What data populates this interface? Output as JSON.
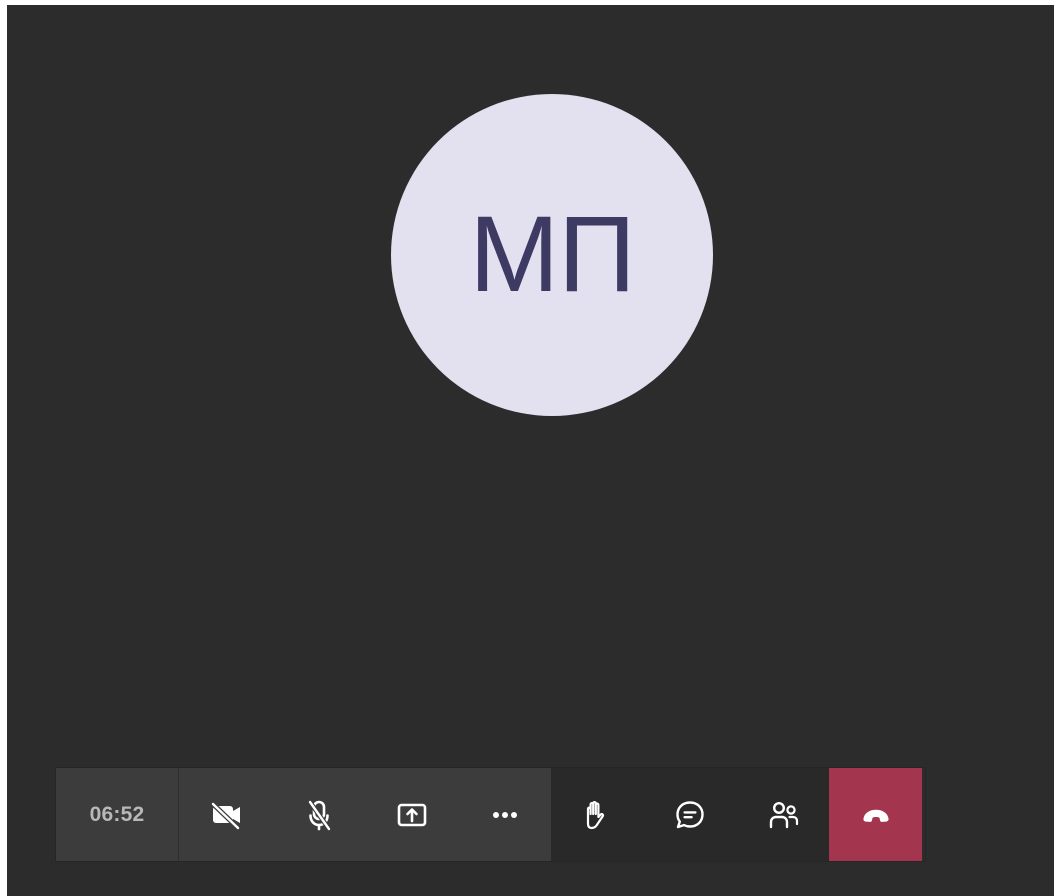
{
  "call": {
    "participant_initials": "МП",
    "elapsed_time": "06:52"
  },
  "controls": {
    "camera": {
      "icon": "camera-off-icon"
    },
    "microphone": {
      "icon": "microphone-off-icon"
    },
    "share": {
      "icon": "share-screen-icon"
    },
    "more": {
      "icon": "more-options-icon"
    },
    "raise_hand": {
      "icon": "raise-hand-icon"
    },
    "chat": {
      "icon": "chat-icon"
    },
    "participants": {
      "icon": "participants-icon"
    },
    "hang_up": {
      "icon": "hang-up-icon"
    }
  },
  "colors": {
    "background": "#2d2c2c",
    "avatar_fill": "#e3e0ef",
    "avatar_text": "#3d3a63",
    "toolbar_primary": "#3d3c3c",
    "toolbar_secondary": "#2a2929",
    "hangup": "#a4354e",
    "icon": "#ffffff",
    "timer_text": "#b8b8b8"
  }
}
